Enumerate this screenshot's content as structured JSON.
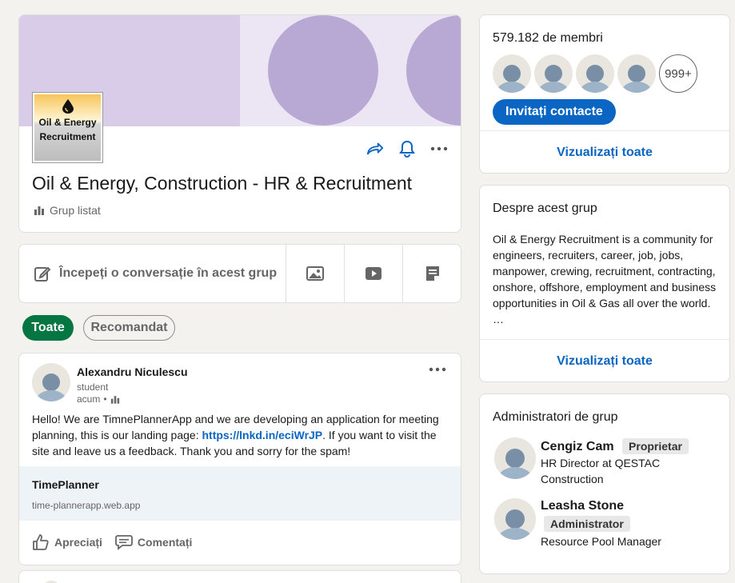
{
  "colors": {
    "brand": "#0a66c2",
    "filter_active": "#057642",
    "banner": "#d8cce8",
    "banner_circle": "#b8a8d4"
  },
  "group": {
    "logo_text_line1": "Oil & Energy",
    "logo_text_line2": "Recruitment",
    "title": "Oil & Energy, Construction - HR & Recruitment",
    "visibility": "Grup listat",
    "icons": [
      "share-icon",
      "bell-icon",
      "more-icon"
    ]
  },
  "composer": {
    "placeholder": "Începeți o conversație în acest grup",
    "icons": [
      "edit-icon",
      "image-icon",
      "video-icon",
      "document-icon"
    ]
  },
  "filters": {
    "all": "Toate",
    "recommended": "Recomandat"
  },
  "post": {
    "author": "Alexandru Niculescu",
    "headline": "student",
    "time": "acum",
    "text_before": "Hello! We are TimnePlannerApp and we are developing an application for meeting planning, this is our landing page: ",
    "link": "https://lnkd.in/eciWrJP",
    "text_after": ". If you want to visit the site and leave us a feedback. Thank you and sorry for the spam!",
    "preview_title": "TimePlanner",
    "preview_url": "time-plannerapp.web.app",
    "like_label": "Apreciați",
    "comment_label": "Comentați"
  },
  "members": {
    "count": "579.182 de membri",
    "more_badge": "999+",
    "invite_label": "Invitați contacte",
    "view_all": "Vizualizați toate"
  },
  "about": {
    "title": "Despre acest grup",
    "text": "Oil & Energy Recruitment is a community for engineers, recruiters, career, job, jobs, manpower, crewing, recruitment, contracting, onshore, offshore, employment and business opportunities in Oil & Gas all over the world.",
    "ellipsis": "…",
    "view_all": "Vizualizați toate"
  },
  "admins": {
    "title": "Administratori de grup",
    "list": [
      {
        "name": "Cengiz Cam",
        "badge": "Proprietar",
        "role": "HR Director at QESTAC Construction"
      },
      {
        "name": "Leasha Stone",
        "badge": "Administrator",
        "role": "Resource Pool Manager"
      }
    ]
  }
}
